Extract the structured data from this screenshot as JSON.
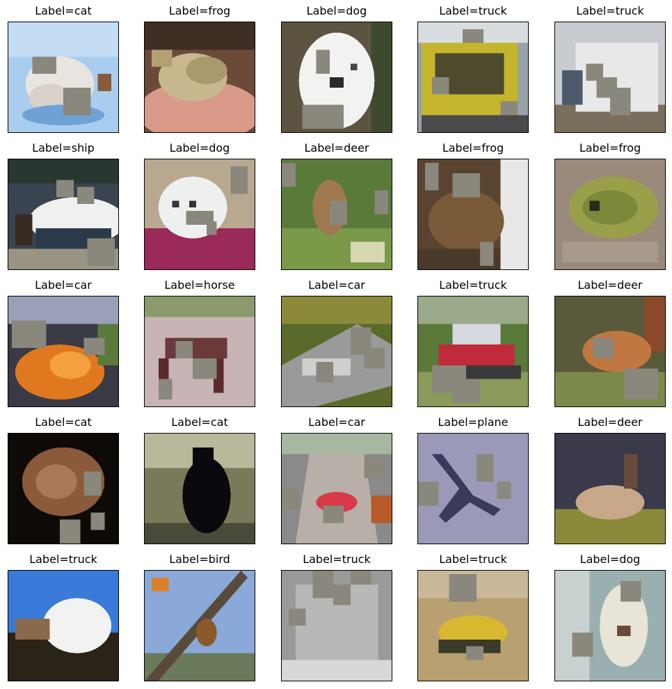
{
  "grid": {
    "items": [
      {
        "label": "Label=cat"
      },
      {
        "label": "Label=frog"
      },
      {
        "label": "Label=dog"
      },
      {
        "label": "Label=truck"
      },
      {
        "label": "Label=truck"
      },
      {
        "label": "Label=ship"
      },
      {
        "label": "Label=dog"
      },
      {
        "label": "Label=deer"
      },
      {
        "label": "Label=frog"
      },
      {
        "label": "Label=frog"
      },
      {
        "label": "Label=car"
      },
      {
        "label": "Label=horse"
      },
      {
        "label": "Label=car"
      },
      {
        "label": "Label=truck"
      },
      {
        "label": "Label=deer"
      },
      {
        "label": "Label=cat"
      },
      {
        "label": "Label=cat"
      },
      {
        "label": "Label=car"
      },
      {
        "label": "Label=plane"
      },
      {
        "label": "Label=deer"
      },
      {
        "label": "Label=truck"
      },
      {
        "label": "Label=bird"
      },
      {
        "label": "Label=truck"
      },
      {
        "label": "Label=truck"
      },
      {
        "label": "Label=dog"
      }
    ]
  },
  "colors": {
    "mask": "#8a877c",
    "border": "#000000"
  }
}
